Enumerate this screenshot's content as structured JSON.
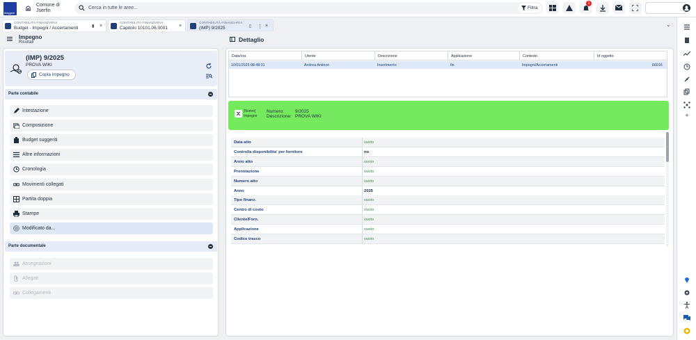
{
  "app": {
    "logo_text": "Maggioli",
    "comune_line1": "Comune di",
    "comune_line2": "Jserfin"
  },
  "search": {
    "placeholder": "Cerca in tutte le aree...",
    "filter_label": "Filtra"
  },
  "notifications": {
    "count": "1"
  },
  "tabs": [
    {
      "category": "CONTABILITÀ FINANZIARIA",
      "title": "Budget - Impegni / Accertamenti"
    },
    {
      "category": "CONTABILITÀ FINANZIARIA",
      "title": "Capitolo 10101.06.0001"
    },
    {
      "category": "CONTABILITÀ FINANZIARIA",
      "title": "(IMP) 9/2025"
    }
  ],
  "left_header": {
    "title": "Impegno",
    "subtitle": "Risultati"
  },
  "right_header": {
    "title": "Dettaglio"
  },
  "card": {
    "title": "(IMP) 9/2025",
    "subtitle": "PROVA WIKI",
    "copy_label": "Copia impegno"
  },
  "sections": {
    "contabile": "Parte contabile",
    "documentale": "Parte documentale"
  },
  "menu_contabile": [
    {
      "label": "Intestazione",
      "icon": "pencil-icon"
    },
    {
      "label": "Composizione",
      "icon": "layers-icon"
    },
    {
      "label": "Budget suggeriti",
      "icon": "budget-icon"
    },
    {
      "label": "Altre informazioni",
      "icon": "list-icon"
    },
    {
      "label": "Cronologia",
      "icon": "history-icon"
    },
    {
      "label": "Movimenti collegati",
      "icon": "link-icon"
    },
    {
      "label": "Partita doppia",
      "icon": "ledger-icon"
    },
    {
      "label": "Stampe",
      "icon": "printer-icon"
    },
    {
      "label": "Modificato da...",
      "icon": "fingerprint-icon"
    }
  ],
  "menu_documentale": [
    {
      "label": "Assegnazioni",
      "icon": "users-icon"
    },
    {
      "label": "Allegati",
      "icon": "attachment-icon"
    },
    {
      "label": "Collegamenti",
      "icon": "link-icon"
    }
  ],
  "table": {
    "headers": [
      "Data/ora",
      "Utente",
      "Descrizione",
      "Applicazione",
      "Contesto",
      "Id oggetto"
    ],
    "row": [
      "10/01/2025 08:48:31",
      "Andrea Antinori",
      "Inserimento",
      "fin",
      "Impegni/Accertamenti",
      "66016"
    ]
  },
  "green": {
    "tag1": "[Nuovo]",
    "tag2": "Impegno",
    "numero_label": "Numero:",
    "numero_value": "9/2025",
    "descr_label": "Descrizione:",
    "descr_value": "PROVA WIKI"
  },
  "details": [
    {
      "key": "Data atto",
      "value": "vuoto"
    },
    {
      "key": "Controlla disponibilita' per fornitore",
      "value": "no"
    },
    {
      "key": "Anno atto",
      "value": "vuoto"
    },
    {
      "key": "Prenotazione",
      "value": "vuoto"
    },
    {
      "key": "Numero atto",
      "value": "vuoto"
    },
    {
      "key": "Anno",
      "value": "2025"
    },
    {
      "key": "Tipo finanz.",
      "value": "vuoto"
    },
    {
      "key": "Centro di costo",
      "value": "vuoto"
    },
    {
      "key": "Cliente/Forn.",
      "value": "vuoto"
    },
    {
      "key": "Applicazione",
      "value": "vuoto"
    },
    {
      "key": "Codice trasco",
      "value": "vuoto"
    }
  ]
}
